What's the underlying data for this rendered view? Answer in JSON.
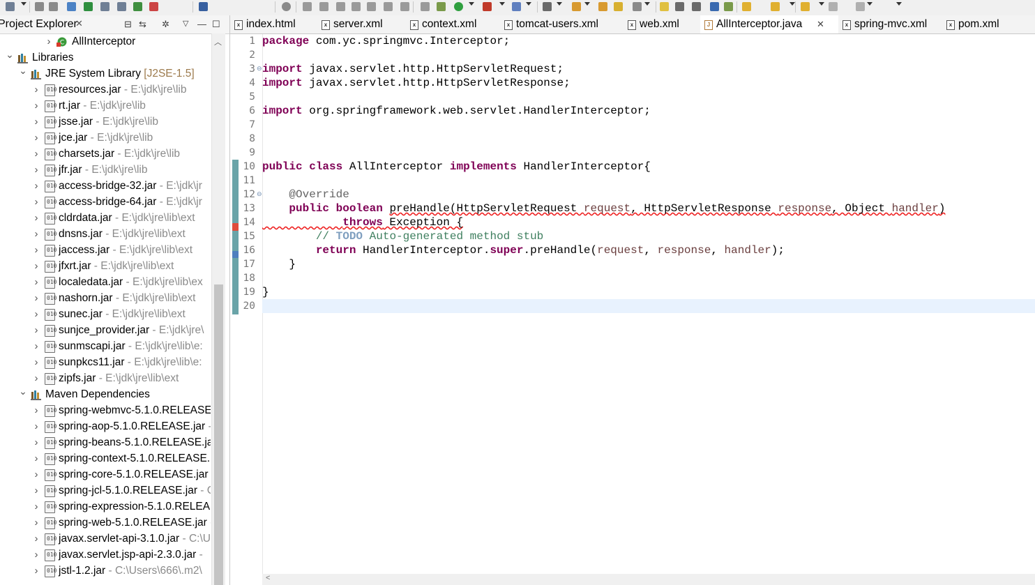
{
  "toolbar": {
    "icons": [
      "new-icon",
      "save-icon",
      "save-all-icon",
      "link-icon",
      "layout-icon",
      "file-icon",
      "doc-icon",
      "server-icon",
      "server2-icon",
      "monitor-icon",
      "debug-icon",
      "resume-icon",
      "suspend-icon",
      "terminate-icon",
      "disconnect-icon",
      "step-into-icon",
      "step-over-icon",
      "step-return-icon",
      "drop-frame-icon",
      "use-step-filters-icon",
      "run-icon",
      "run-config-icon",
      "ext-tools-icon",
      "new-server-icon",
      "new-project-icon",
      "open-type-icon",
      "open-task-icon",
      "search-icon",
      "annotations-icon",
      "mark-occurrences-icon",
      "word-wrap-icon",
      "show-whitespace-icon",
      "block-select-icon",
      "next-annotation-icon",
      "prev-annotation-icon",
      "last-edit-icon",
      "back-icon",
      "forward-icon"
    ]
  },
  "explorer": {
    "title": "Project Explorer",
    "close_glyph": "✕",
    "top_item": "AllInterceptor",
    "libraries_label": "Libraries",
    "jre_label": "JRE System Library",
    "jre_decoration": "[J2SE-1.5]",
    "jre_jars": [
      {
        "name": "resources.jar",
        "path": " - E:\\jdk\\jre\\lib"
      },
      {
        "name": "rt.jar",
        "path": " - E:\\jdk\\jre\\lib"
      },
      {
        "name": "jsse.jar",
        "path": " - E:\\jdk\\jre\\lib"
      },
      {
        "name": "jce.jar",
        "path": " - E:\\jdk\\jre\\lib"
      },
      {
        "name": "charsets.jar",
        "path": " - E:\\jdk\\jre\\lib"
      },
      {
        "name": "jfr.jar",
        "path": " - E:\\jdk\\jre\\lib"
      },
      {
        "name": "access-bridge-32.jar",
        "path": " - E:\\jdk\\jr"
      },
      {
        "name": "access-bridge-64.jar",
        "path": " - E:\\jdk\\jr"
      },
      {
        "name": "cldrdata.jar",
        "path": " - E:\\jdk\\jre\\lib\\ext"
      },
      {
        "name": "dnsns.jar",
        "path": " - E:\\jdk\\jre\\lib\\ext"
      },
      {
        "name": "jaccess.jar",
        "path": " - E:\\jdk\\jre\\lib\\ext"
      },
      {
        "name": "jfxrt.jar",
        "path": " - E:\\jdk\\jre\\lib\\ext"
      },
      {
        "name": "localedata.jar",
        "path": " - E:\\jdk\\jre\\lib\\ex"
      },
      {
        "name": "nashorn.jar",
        "path": " - E:\\jdk\\jre\\lib\\ext"
      },
      {
        "name": "sunec.jar",
        "path": " - E:\\jdk\\jre\\lib\\ext"
      },
      {
        "name": "sunjce_provider.jar",
        "path": " - E:\\jdk\\jre\\"
      },
      {
        "name": "sunmscapi.jar",
        "path": " - E:\\jdk\\jre\\lib\\e:"
      },
      {
        "name": "sunpkcs11.jar",
        "path": " - E:\\jdk\\jre\\lib\\e:"
      },
      {
        "name": "zipfs.jar",
        "path": " - E:\\jdk\\jre\\lib\\ext"
      }
    ],
    "maven_label": "Maven Dependencies",
    "maven_jars": [
      {
        "name": "spring-webmvc-5.1.0.RELEASE",
        "path": ""
      },
      {
        "name": "spring-aop-5.1.0.RELEASE.jar",
        "path": " -"
      },
      {
        "name": "spring-beans-5.1.0.RELEASE.ja",
        "path": ""
      },
      {
        "name": "spring-context-5.1.0.RELEASE.",
        "path": ""
      },
      {
        "name": "spring-core-5.1.0.RELEASE.jar",
        "path": ""
      },
      {
        "name": "spring-jcl-5.1.0.RELEASE.jar",
        "path": " - C"
      },
      {
        "name": "spring-expression-5.1.0.RELEA",
        "path": ""
      },
      {
        "name": "spring-web-5.1.0.RELEASE.jar",
        "path": " -"
      },
      {
        "name": "javax.servlet-api-3.1.0.jar",
        "path": " - C:\\U"
      },
      {
        "name": "javax.servlet.jsp-api-2.3.0.jar",
        "path": " -"
      },
      {
        "name": "jstl-1.2.jar",
        "path": " - C:\\Users\\666\\.m2\\"
      }
    ]
  },
  "editor": {
    "tabs": [
      {
        "label": "index.html",
        "icon": "html",
        "active": false
      },
      {
        "label": "server.xml",
        "icon": "xml",
        "active": false
      },
      {
        "label": "context.xml",
        "icon": "xml",
        "active": false
      },
      {
        "label": "tomcat-users.xml",
        "icon": "xml",
        "active": false
      },
      {
        "label": "web.xml",
        "icon": "xml",
        "active": false
      },
      {
        "label": "AllInterceptor.java",
        "icon": "java",
        "active": true
      },
      {
        "label": "spring-mvc.xml",
        "icon": "xml",
        "active": false
      },
      {
        "label": "pom.xml",
        "icon": "xml",
        "active": false
      }
    ],
    "tab_close_glyph": "✕",
    "line_numbers": [
      "1",
      "2",
      "3",
      "4",
      "5",
      "6",
      "7",
      "8",
      "9",
      "10",
      "11",
      "12",
      "13",
      "14",
      "15",
      "16",
      "17",
      "18",
      "19",
      "20"
    ],
    "code": {
      "l1_kw": "package",
      "l1_rest": " com.yc.springmvc.Interceptor;",
      "l3_kw": "import",
      "l3_rest": " javax.servlet.http.HttpServletRequest;",
      "l4_kw": "import",
      "l4_rest": " javax.servlet.http.HttpServletResponse;",
      "l6_kw": "import",
      "l6_rest": " org.springframework.web.servlet.HandlerInterceptor;",
      "l10_kw1": "public",
      "l10_kw2": "class",
      "l10_name": " AllInterceptor ",
      "l10_kw3": "implements",
      "l10_rest": " HandlerInterceptor{",
      "l12_ann": "@Override",
      "l13_kw1": "public",
      "l13_kw2": "boolean",
      "l13_sig": "preHandle(HttpServletRequest ",
      "l13_p1": "request",
      "l13_mid1": ", HttpServletResponse ",
      "l13_p2": "response",
      "l13_mid2": ", Object ",
      "l13_p3": "handler",
      "l13_end": ")",
      "l14_kw": "throws",
      "l14_rest": " Exception {",
      "l15_c1": "// ",
      "l15_todo": "TODO",
      "l15_c2": " Auto-generated method stub",
      "l16_kw": "return",
      "l16_mid": " HandlerInterceptor.",
      "l16_kw2": "super",
      "l16_call": ".preHandle(",
      "l16_p1": "request",
      "l16_s1": ", ",
      "l16_p2": "response",
      "l16_s2": ", ",
      "l16_p3": "handler",
      "l16_end": ");",
      "l17": "}",
      "l19": "}"
    },
    "hscroll_left_glyph": "<"
  }
}
